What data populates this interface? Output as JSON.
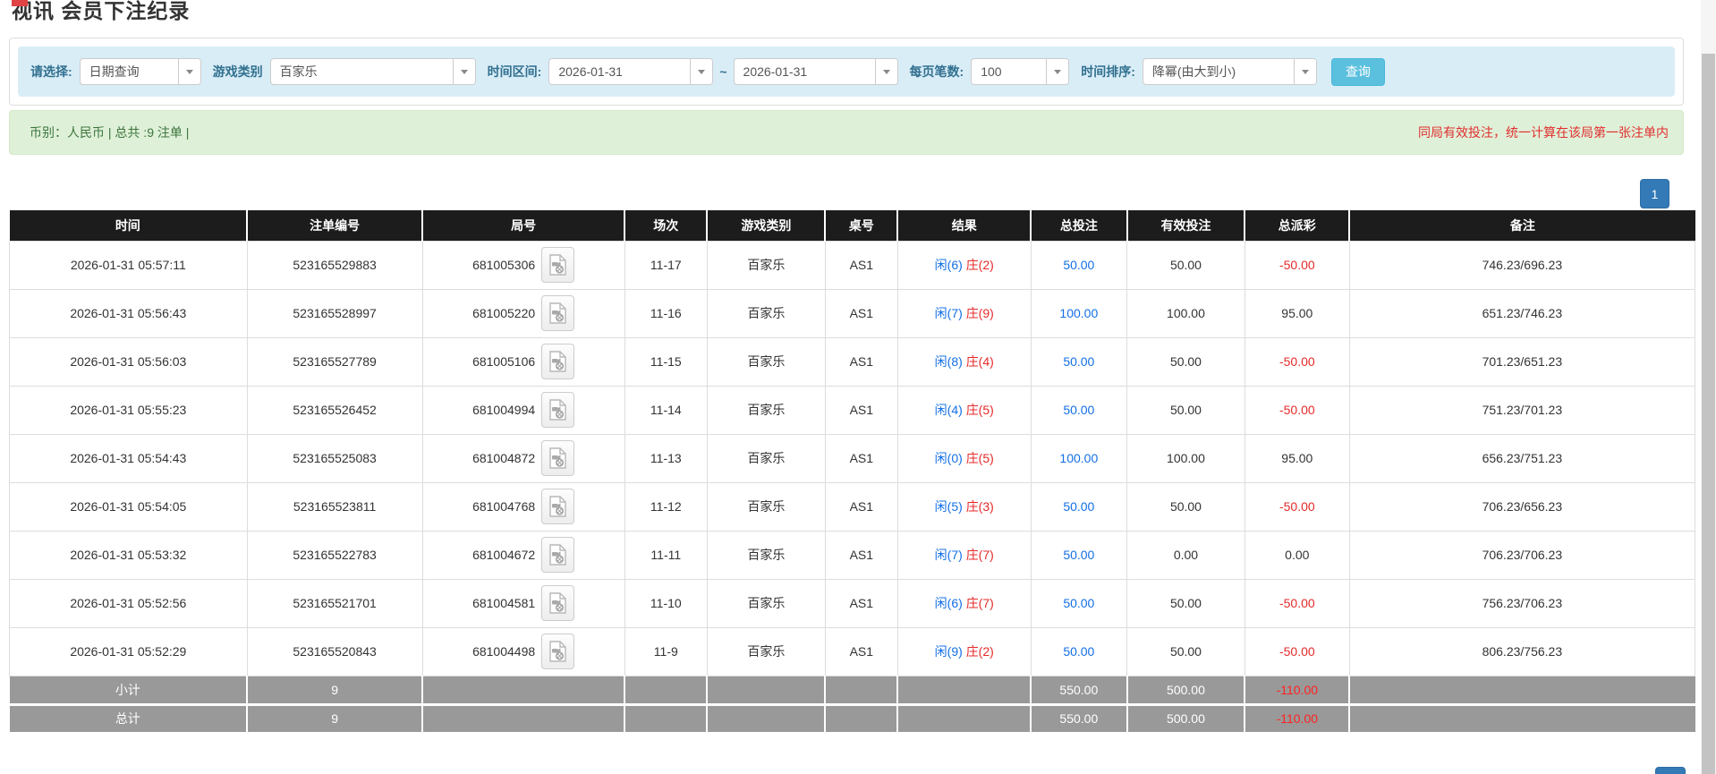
{
  "page": {
    "title": "视讯 会员下注纪录"
  },
  "filters": {
    "query_type": {
      "label": "请选择:",
      "value": "日期查询"
    },
    "game_category": {
      "label": "游戏类别",
      "value": "百家乐"
    },
    "time_range": {
      "label": "时间区间:",
      "from": "2026-01-31",
      "separator": "~",
      "to": "2026-01-31"
    },
    "page_size": {
      "label": "每页笔数:",
      "value": "100"
    },
    "time_sort": {
      "label": "时间排序:",
      "value": "降幂(由大到小)"
    },
    "search_button": "查询"
  },
  "summary": {
    "left_text": "币别：人民币 | 总共 :9 注单 |",
    "right_notice": "同局有效投注，统一计算在该局第一张注单内"
  },
  "pagination": {
    "current_page": "1"
  },
  "icons": {
    "video_icon": "video-replay-file",
    "dropdown_icon": "chevron-down"
  },
  "colors": {
    "accent_blue": "#1470e6",
    "banker_red": "#e62a2a",
    "header_black": "#1c1c1c",
    "footer_gray": "#999999",
    "panel_blue": "#d9edf7",
    "summary_green": "#dff0d8",
    "button_cyan": "#5bc0de",
    "pager_blue": "#337ab7",
    "footer_red": "#ff2222"
  },
  "table": {
    "columns": [
      "时间",
      "注单编号",
      "局号",
      "场次",
      "游戏类别",
      "桌号",
      "结果",
      "总投注",
      "有效投注",
      "总派彩",
      "备注"
    ],
    "col_widths_pct": [
      14.1,
      10.4,
      12.0,
      4.9,
      7.0,
      4.3,
      7.9,
      5.7,
      7.0,
      6.2,
      20.5
    ],
    "rows": [
      {
        "time": "2026-01-31 05:57:11",
        "bet_id": "523165529883",
        "round_id": "681005306",
        "session": "11-17",
        "game": "百家乐",
        "table_no": "AS1",
        "result_player": "闲(6)",
        "result_banker": "庄(2)",
        "total_bet": "50.00",
        "valid_bet": "50.00",
        "payout": "-50.00",
        "remark": "746.23/696.23"
      },
      {
        "time": "2026-01-31 05:56:43",
        "bet_id": "523165528997",
        "round_id": "681005220",
        "session": "11-16",
        "game": "百家乐",
        "table_no": "AS1",
        "result_player": "闲(7)",
        "result_banker": "庄(9)",
        "total_bet": "100.00",
        "valid_bet": "100.00",
        "payout": "95.00",
        "remark": "651.23/746.23"
      },
      {
        "time": "2026-01-31 05:56:03",
        "bet_id": "523165527789",
        "round_id": "681005106",
        "session": "11-15",
        "game": "百家乐",
        "table_no": "AS1",
        "result_player": "闲(8)",
        "result_banker": "庄(4)",
        "total_bet": "50.00",
        "valid_bet": "50.00",
        "payout": "-50.00",
        "remark": "701.23/651.23"
      },
      {
        "time": "2026-01-31 05:55:23",
        "bet_id": "523165526452",
        "round_id": "681004994",
        "session": "11-14",
        "game": "百家乐",
        "table_no": "AS1",
        "result_player": "闲(4)",
        "result_banker": "庄(5)",
        "total_bet": "50.00",
        "valid_bet": "50.00",
        "payout": "-50.00",
        "remark": "751.23/701.23"
      },
      {
        "time": "2026-01-31 05:54:43",
        "bet_id": "523165525083",
        "round_id": "681004872",
        "session": "11-13",
        "game": "百家乐",
        "table_no": "AS1",
        "result_player": "闲(0)",
        "result_banker": "庄(5)",
        "total_bet": "100.00",
        "valid_bet": "100.00",
        "payout": "95.00",
        "remark": "656.23/751.23"
      },
      {
        "time": "2026-01-31 05:54:05",
        "bet_id": "523165523811",
        "round_id": "681004768",
        "session": "11-12",
        "game": "百家乐",
        "table_no": "AS1",
        "result_player": "闲(5)",
        "result_banker": "庄(3)",
        "total_bet": "50.00",
        "valid_bet": "50.00",
        "payout": "-50.00",
        "remark": "706.23/656.23"
      },
      {
        "time": "2026-01-31 05:53:32",
        "bet_id": "523165522783",
        "round_id": "681004672",
        "session": "11-11",
        "game": "百家乐",
        "table_no": "AS1",
        "result_player": "闲(7)",
        "result_banker": "庄(7)",
        "total_bet": "50.00",
        "valid_bet": "0.00",
        "payout": "0.00",
        "remark": "706.23/706.23"
      },
      {
        "time": "2026-01-31 05:52:56",
        "bet_id": "523165521701",
        "round_id": "681004581",
        "session": "11-10",
        "game": "百家乐",
        "table_no": "AS1",
        "result_player": "闲(6)",
        "result_banker": "庄(7)",
        "total_bet": "50.00",
        "valid_bet": "50.00",
        "payout": "-50.00",
        "remark": "756.23/706.23"
      },
      {
        "time": "2026-01-31 05:52:29",
        "bet_id": "523165520843",
        "round_id": "681004498",
        "session": "11-9",
        "game": "百家乐",
        "table_no": "AS1",
        "result_player": "闲(9)",
        "result_banker": "庄(2)",
        "total_bet": "50.00",
        "valid_bet": "50.00",
        "payout": "-50.00",
        "remark": "806.23/756.23"
      }
    ],
    "footer": [
      {
        "label": "小计",
        "count": "9",
        "total_bet": "550.00",
        "valid_bet": "500.00",
        "payout": "-110.00"
      },
      {
        "label": "总计",
        "count": "9",
        "total_bet": "550.00",
        "valid_bet": "500.00",
        "payout": "-110.00"
      }
    ]
  }
}
